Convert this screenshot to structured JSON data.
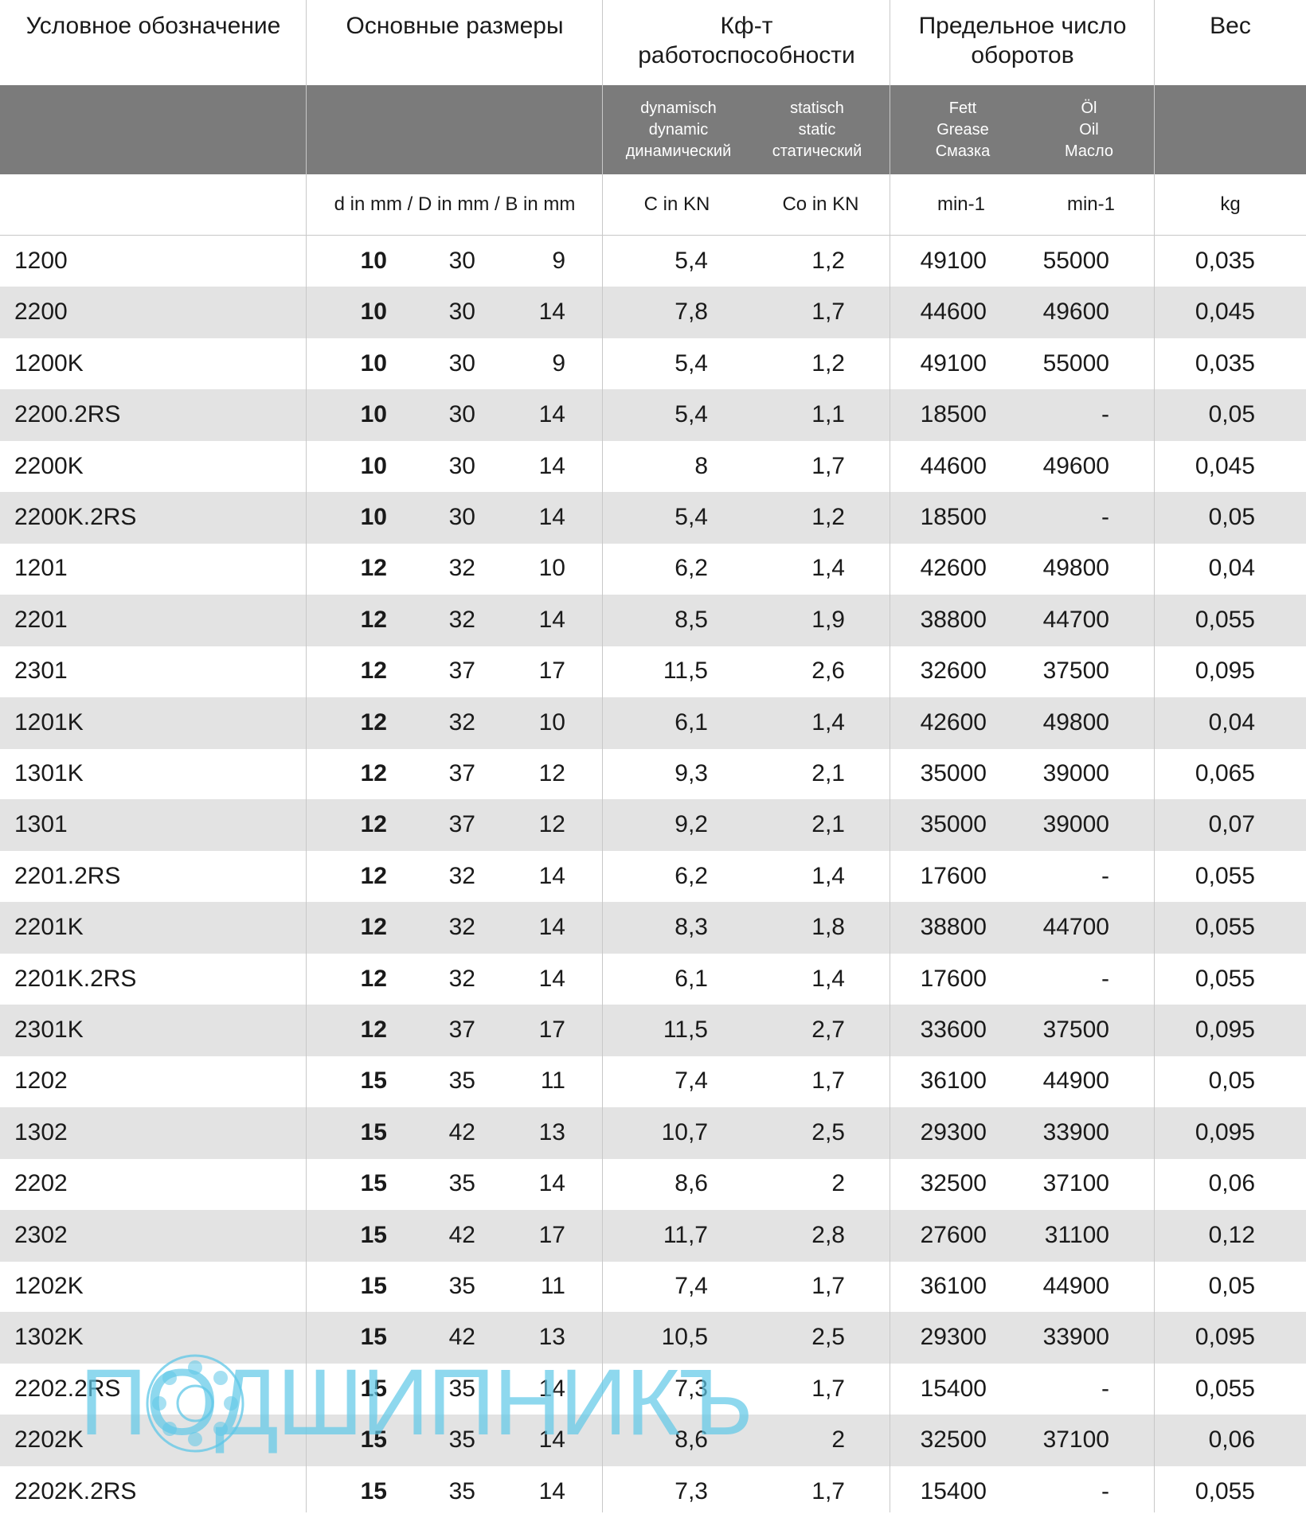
{
  "header": {
    "col_designation": "Условное обозначение",
    "col_dimensions": "Основные размеры",
    "col_capacity": [
      "Кф-т",
      "работоспособности"
    ],
    "col_speed": [
      "Предельное число",
      "оборотов"
    ],
    "col_weight": "Вес",
    "dynamic": [
      "dynamisch",
      "dynamic",
      "динамический"
    ],
    "static": [
      "statisch",
      "static",
      "статический"
    ],
    "grease": [
      "Fett",
      "Grease",
      "Смазка"
    ],
    "oil": [
      "Öl",
      "Oil",
      "Масло"
    ],
    "units_dimensions": "d in mm / D in mm / B in mm",
    "units_c": "C in KN",
    "units_co": "Co in KN",
    "units_grease": "min-1",
    "units_oil": "min-1",
    "units_weight": "kg"
  },
  "rows": [
    [
      "1200",
      "10",
      "30",
      "9",
      "5,4",
      "1,2",
      "49100",
      "55000",
      "0,035"
    ],
    [
      "2200",
      "10",
      "30",
      "14",
      "7,8",
      "1,7",
      "44600",
      "49600",
      "0,045"
    ],
    [
      "1200K",
      "10",
      "30",
      "9",
      "5,4",
      "1,2",
      "49100",
      "55000",
      "0,035"
    ],
    [
      "2200.2RS",
      "10",
      "30",
      "14",
      "5,4",
      "1,1",
      "18500",
      "-",
      "0,05"
    ],
    [
      "2200K",
      "10",
      "30",
      "14",
      "8",
      "1,7",
      "44600",
      "49600",
      "0,045"
    ],
    [
      "2200K.2RS",
      "10",
      "30",
      "14",
      "5,4",
      "1,2",
      "18500",
      "-",
      "0,05"
    ],
    [
      "1201",
      "12",
      "32",
      "10",
      "6,2",
      "1,4",
      "42600",
      "49800",
      "0,04"
    ],
    [
      "2201",
      "12",
      "32",
      "14",
      "8,5",
      "1,9",
      "38800",
      "44700",
      "0,055"
    ],
    [
      "2301",
      "12",
      "37",
      "17",
      "11,5",
      "2,6",
      "32600",
      "37500",
      "0,095"
    ],
    [
      "1201K",
      "12",
      "32",
      "10",
      "6,1",
      "1,4",
      "42600",
      "49800",
      "0,04"
    ],
    [
      "1301K",
      "12",
      "37",
      "12",
      "9,3",
      "2,1",
      "35000",
      "39000",
      "0,065"
    ],
    [
      "1301",
      "12",
      "37",
      "12",
      "9,2",
      "2,1",
      "35000",
      "39000",
      "0,07"
    ],
    [
      "2201.2RS",
      "12",
      "32",
      "14",
      "6,2",
      "1,4",
      "17600",
      "-",
      "0,055"
    ],
    [
      "2201K",
      "12",
      "32",
      "14",
      "8,3",
      "1,8",
      "38800",
      "44700",
      "0,055"
    ],
    [
      "2201K.2RS",
      "12",
      "32",
      "14",
      "6,1",
      "1,4",
      "17600",
      "-",
      "0,055"
    ],
    [
      "2301K",
      "12",
      "37",
      "17",
      "11,5",
      "2,7",
      "33600",
      "37500",
      "0,095"
    ],
    [
      "1202",
      "15",
      "35",
      "11",
      "7,4",
      "1,7",
      "36100",
      "44900",
      "0,05"
    ],
    [
      "1302",
      "15",
      "42",
      "13",
      "10,7",
      "2,5",
      "29300",
      "33900",
      "0,095"
    ],
    [
      "2202",
      "15",
      "35",
      "14",
      "8,6",
      "2",
      "32500",
      "37100",
      "0,06"
    ],
    [
      "2302",
      "15",
      "42",
      "17",
      "11,7",
      "2,8",
      "27600",
      "31100",
      "0,12"
    ],
    [
      "1202K",
      "15",
      "35",
      "11",
      "7,4",
      "1,7",
      "36100",
      "44900",
      "0,05"
    ],
    [
      "1302K",
      "15",
      "42",
      "13",
      "10,5",
      "2,5",
      "29300",
      "33900",
      "0,095"
    ],
    [
      "2202.2RS",
      "15",
      "35",
      "14",
      "7,3",
      "1,7",
      "15400",
      "-",
      "0,055"
    ],
    [
      "2202K",
      "15",
      "35",
      "14",
      "8,6",
      "2",
      "32500",
      "37100",
      "0,06"
    ],
    [
      "2202K.2RS",
      "15",
      "35",
      "14",
      "7,3",
      "1,7",
      "15400",
      "-",
      "0,055"
    ]
  ],
  "watermark": {
    "text": "ПОДШИПНИКЪ"
  },
  "colors": {
    "band": "#7b7b7b",
    "stripe": "#e3e3e3",
    "watermark": "#5fc8e8"
  }
}
